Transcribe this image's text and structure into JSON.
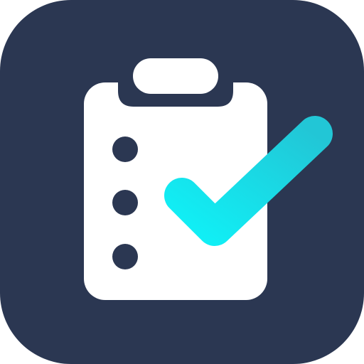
{
  "icon": {
    "name": "checklist-clipboard-app-icon",
    "colors": {
      "tile_background": "#2b3752",
      "clipboard": "#ffffff",
      "bullet_dots": "#2b3752",
      "check_light": "#10f0f6",
      "check_dark": "#22c6d6"
    },
    "checklist_bullet_count": 3
  }
}
